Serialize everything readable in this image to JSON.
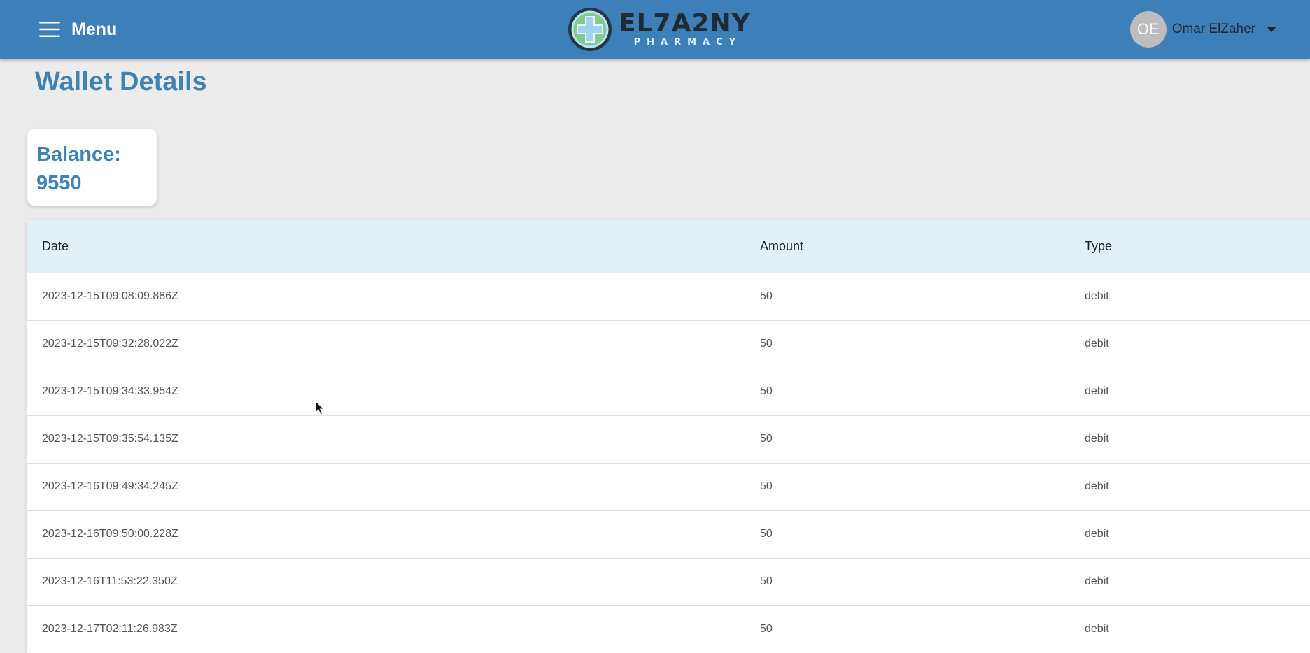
{
  "header": {
    "menu_label": "Menu",
    "menu_icon": "hamburger-icon",
    "logo_name": "EL7A2NY",
    "logo_sub": "PHARMACY",
    "user": {
      "initials": "OE",
      "name": "Omar ElZaher",
      "dropdown_icon": "caret-down-icon"
    }
  },
  "page": {
    "title": "Wallet Details"
  },
  "balance": {
    "label": "Balance:",
    "value": "9550"
  },
  "table": {
    "columns": {
      "date": "Date",
      "amount": "Amount",
      "type": "Type"
    },
    "rows": [
      {
        "date": "2023-12-15T09:08:09.886Z",
        "amount": "50",
        "type": "debit"
      },
      {
        "date": "2023-12-15T09:32:28.022Z",
        "amount": "50",
        "type": "debit"
      },
      {
        "date": "2023-12-15T09:34:33.954Z",
        "amount": "50",
        "type": "debit"
      },
      {
        "date": "2023-12-15T09:35:54.135Z",
        "amount": "50",
        "type": "debit"
      },
      {
        "date": "2023-12-16T09:49:34.245Z",
        "amount": "50",
        "type": "debit"
      },
      {
        "date": "2023-12-16T09:50:00.228Z",
        "amount": "50",
        "type": "debit"
      },
      {
        "date": "2023-12-16T11:53:22.350Z",
        "amount": "50",
        "type": "debit"
      },
      {
        "date": "2023-12-17T02:11:26.983Z",
        "amount": "50",
        "type": "debit"
      }
    ]
  },
  "colors": {
    "header_bg": "#3d7fb8",
    "accent": "#3f83b4",
    "table_header_bg": "#e2f0f8",
    "page_bg": "#ececec"
  }
}
